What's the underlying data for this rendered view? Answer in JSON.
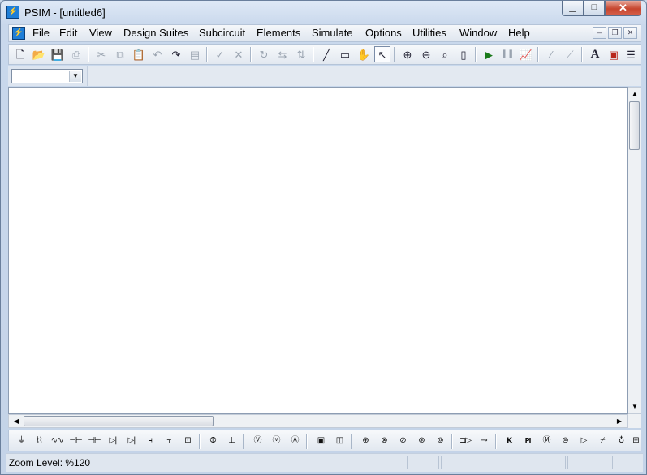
{
  "window": {
    "title": "PSIM - [untitled6]",
    "min_glyph": "▁",
    "max_glyph": "□",
    "close_glyph": "✕"
  },
  "menubar": {
    "items": [
      {
        "label": "File"
      },
      {
        "label": "Edit"
      },
      {
        "label": "View"
      },
      {
        "label": "Design Suites"
      },
      {
        "label": "Subcircuit"
      },
      {
        "label": "Elements"
      },
      {
        "label": "Simulate"
      },
      {
        "label": "Options"
      },
      {
        "label": "Utilities"
      },
      {
        "label": "Window"
      },
      {
        "label": "Help"
      }
    ],
    "mdi": {
      "min_glyph": "–",
      "restore_glyph": "❐",
      "close_glyph": "✕"
    }
  },
  "toolbar": {
    "buttons": [
      {
        "name": "new-icon",
        "glyph": "🗋"
      },
      {
        "name": "open-icon",
        "glyph": "📂"
      },
      {
        "name": "save-icon",
        "glyph": "💾"
      },
      {
        "name": "print-icon",
        "glyph": "⎙"
      },
      {
        "name": "cut-icon",
        "glyph": "✂"
      },
      {
        "name": "copy-icon",
        "glyph": "⧉"
      },
      {
        "name": "paste-icon",
        "glyph": "📋"
      },
      {
        "name": "undo-icon",
        "glyph": "↶"
      },
      {
        "name": "redo-icon",
        "glyph": "↷"
      },
      {
        "name": "clipboard-icon",
        "glyph": "▤"
      },
      {
        "name": "check-icon",
        "glyph": "✓"
      },
      {
        "name": "delete-icon",
        "glyph": "✕"
      },
      {
        "name": "rotate-icon",
        "glyph": "↻"
      },
      {
        "name": "flip-horizontal-icon",
        "glyph": "⇆"
      },
      {
        "name": "flip-vertical-icon",
        "glyph": "⇅"
      },
      {
        "name": "wire-icon",
        "glyph": "╱"
      },
      {
        "name": "label-icon",
        "glyph": "▭"
      },
      {
        "name": "pan-hand-icon",
        "glyph": "✋"
      },
      {
        "name": "select-arrow-icon",
        "glyph": "↖"
      },
      {
        "name": "zoom-in-icon",
        "glyph": "⊕"
      },
      {
        "name": "zoom-out-icon",
        "glyph": "⊖"
      },
      {
        "name": "zoom-area-icon",
        "glyph": "⌕"
      },
      {
        "name": "fit-page-icon",
        "glyph": "▯"
      },
      {
        "name": "run-simulation-icon",
        "glyph": "▶"
      },
      {
        "name": "pause-simulation-icon",
        "glyph": "❚❚"
      },
      {
        "name": "simview-icon",
        "glyph": "📈"
      },
      {
        "name": "draw-line-icon",
        "glyph": "∕"
      },
      {
        "name": "draw-curve-icon",
        "glyph": "⟋"
      },
      {
        "name": "text-icon",
        "glyph": "A"
      },
      {
        "name": "image-icon",
        "glyph": "▣"
      },
      {
        "name": "list-icon",
        "glyph": "☰"
      }
    ]
  },
  "combo": {
    "value": "",
    "arrow_glyph": "▼"
  },
  "scroll": {
    "up_glyph": "▲",
    "down_glyph": "▼",
    "left_glyph": "◀",
    "right_glyph": "▶"
  },
  "elements_toolbar": {
    "items": [
      {
        "name": "ground-icon",
        "glyph": "⏚"
      },
      {
        "name": "resistor-icon",
        "glyph": "⌇⌇"
      },
      {
        "name": "inductor-icon",
        "glyph": "∿∿"
      },
      {
        "name": "capacitor-icon",
        "glyph": "⊣⊢"
      },
      {
        "name": "electrolytic-capacitor-icon",
        "glyph": "⊣⊢"
      },
      {
        "name": "diode-icon",
        "glyph": "▷|"
      },
      {
        "name": "thyristor-icon",
        "glyph": "▷|"
      },
      {
        "name": "mosfet-icon",
        "glyph": "⫞"
      },
      {
        "name": "igbt-icon",
        "glyph": "⫟"
      },
      {
        "name": "switch-module-icon",
        "glyph": "⊡"
      },
      {
        "name": "transformer-icon",
        "glyph": "⦷"
      },
      {
        "name": "dc-source-icon",
        "glyph": "⊥"
      },
      {
        "name": "voltage-probe-icon",
        "glyph": "Ⓥ"
      },
      {
        "name": "voltmeter-icon",
        "glyph": "ⓥ"
      },
      {
        "name": "ammeter-icon",
        "glyph": "Ⓐ"
      },
      {
        "name": "scope-icon",
        "glyph": "▣"
      },
      {
        "name": "dc-scope-icon",
        "glyph": "◫"
      },
      {
        "name": "ac-source-icon",
        "glyph": "⊕"
      },
      {
        "name": "sine-source-icon",
        "glyph": "⊗"
      },
      {
        "name": "square-source-icon",
        "glyph": "⊘"
      },
      {
        "name": "triangle-source-icon",
        "glyph": "⊛"
      },
      {
        "name": "current-source-icon",
        "glyph": "⊚"
      },
      {
        "name": "zoh-icon",
        "glyph": "⊐▷"
      },
      {
        "name": "comparator-icon",
        "glyph": "⊸"
      },
      {
        "name": "gain-block-icon",
        "glyph": "K"
      },
      {
        "name": "pi-controller-icon",
        "glyph": "PI"
      },
      {
        "name": "motor-icon",
        "glyph": "Ⓜ"
      },
      {
        "name": "sensor-icon",
        "glyph": "⊜"
      },
      {
        "name": "op-amp-icon",
        "glyph": "▷"
      },
      {
        "name": "limiter-icon",
        "glyph": "⌿"
      },
      {
        "name": "node-icon",
        "glyph": "♁"
      },
      {
        "name": "more-elements-icon",
        "glyph": "⊞"
      }
    ]
  },
  "status": {
    "text": "Zoom Level: %120"
  }
}
